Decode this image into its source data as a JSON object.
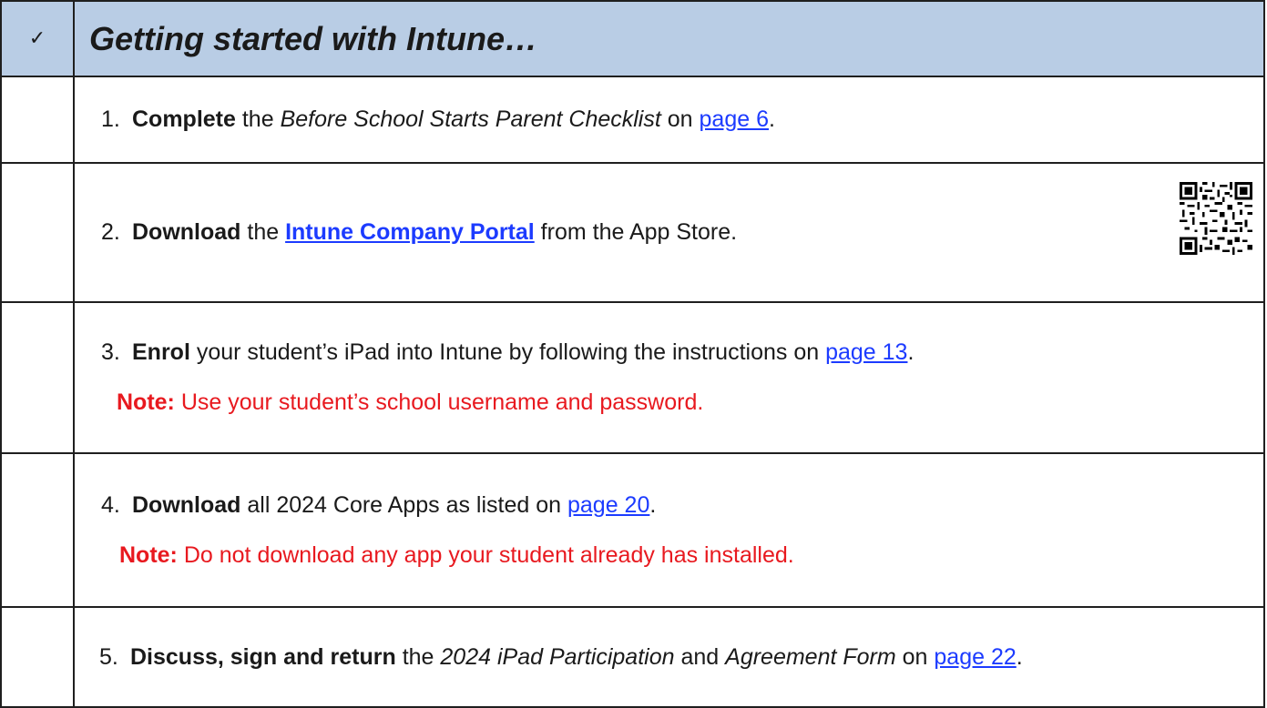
{
  "header": {
    "check_symbol": "✓",
    "title": "Getting started with Intune…"
  },
  "items": [
    {
      "number": "1.",
      "keyword": "Complete",
      "text_a": " the ",
      "italic_a": "Before School Starts Parent Checklist",
      "text_b": " on ",
      "link": "page 6",
      "end": "."
    },
    {
      "number": "2.",
      "keyword": "Download",
      "text_a": " the ",
      "link": "Intune Company Portal",
      "text_b": " from the App Store.",
      "qr_icon": "qr-code-icon"
    },
    {
      "number": "3.",
      "keyword": "Enrol",
      "text_a": " your student’s iPad into Intune by following the instructions on ",
      "link": "page 13",
      "end": ".",
      "note_label": "Note:",
      "note_text": " Use your student’s school username and password."
    },
    {
      "number": "4.",
      "keyword": "Download",
      "text_a": " all 2024 Core Apps as listed on ",
      "link": "page 20",
      "end": ".",
      "note_label": "Note:",
      "note_text": " Do not download any app your student already has installed."
    },
    {
      "number": "5.",
      "keyword": "Discuss, sign and return",
      "text_a": " the ",
      "italic_a": "2024 iPad Participation",
      "text_b": " and ",
      "italic_b": "Agreement Form",
      "text_c": " on ",
      "link": "page 22",
      "end": "."
    }
  ],
  "colors": {
    "header_bg": "#b9cde5",
    "link": "#1c3bff",
    "note": "#e8191f",
    "border": "#1f1f1f"
  }
}
